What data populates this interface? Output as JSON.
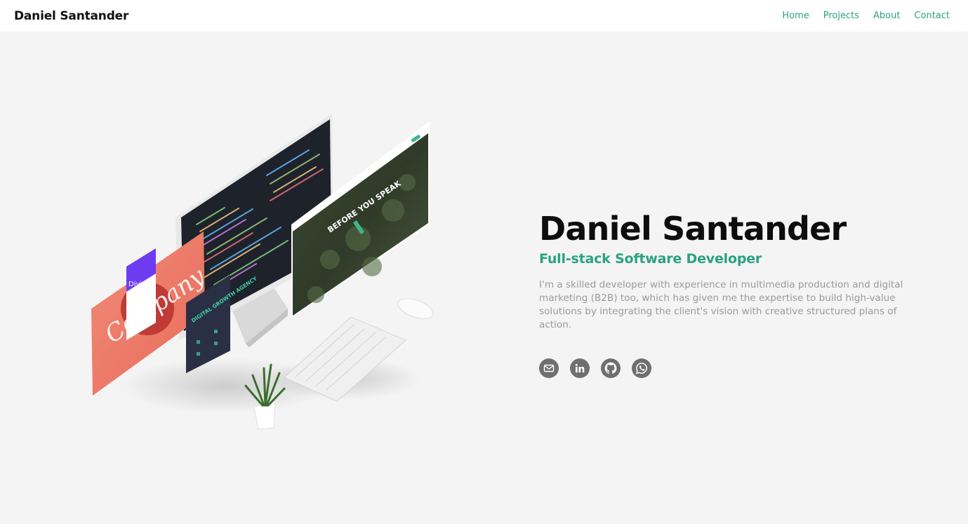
{
  "header": {
    "brand": "Daniel Santander",
    "nav": [
      {
        "label": "Home"
      },
      {
        "label": "Projects"
      },
      {
        "label": "About"
      },
      {
        "label": "Contact"
      }
    ]
  },
  "hero": {
    "name": "Daniel Santander",
    "role": "Full-stack Software Developer",
    "bio": "I'm a skilled developer with experience in multimedia production and digital marketing (B2B) too, which has given me the expertise to build high-value solutions by integrating the client's vision with creative structured plans of action.",
    "social": [
      {
        "icon": "email-icon"
      },
      {
        "icon": "linkedin-icon"
      },
      {
        "icon": "github-icon"
      },
      {
        "icon": "whatsapp-icon"
      }
    ]
  },
  "illustration": {
    "screen_title": "BEFORE YOU SPEAK",
    "card_text": "Company",
    "poster_text": "DIGITAL GROWTH AGENCY",
    "phone_text": "Divi"
  },
  "colors": {
    "accent": "#2aa183",
    "background": "#f4f4f4",
    "icon_bg": "#6f6f6f"
  }
}
